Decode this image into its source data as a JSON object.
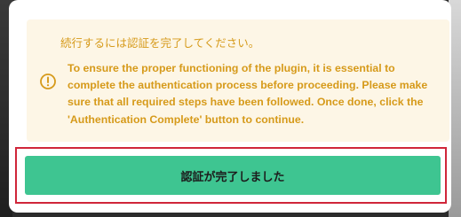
{
  "notice": {
    "title": "続行するには認証を完了してください。",
    "message": "To ensure the proper functioning of the plugin, it is essential to complete the authentication process before proceeding. Please make sure that all required steps have been followed. Once done, click the 'Authentication Complete' button to continue.",
    "icon": "warning-circle-icon"
  },
  "actions": {
    "complete_label": "認証が完了しました"
  },
  "colors": {
    "notice_background": "#fdf6e6",
    "notice_text": "#d69a1a",
    "button_background": "#3ec591",
    "highlight_border": "#d0263a"
  }
}
